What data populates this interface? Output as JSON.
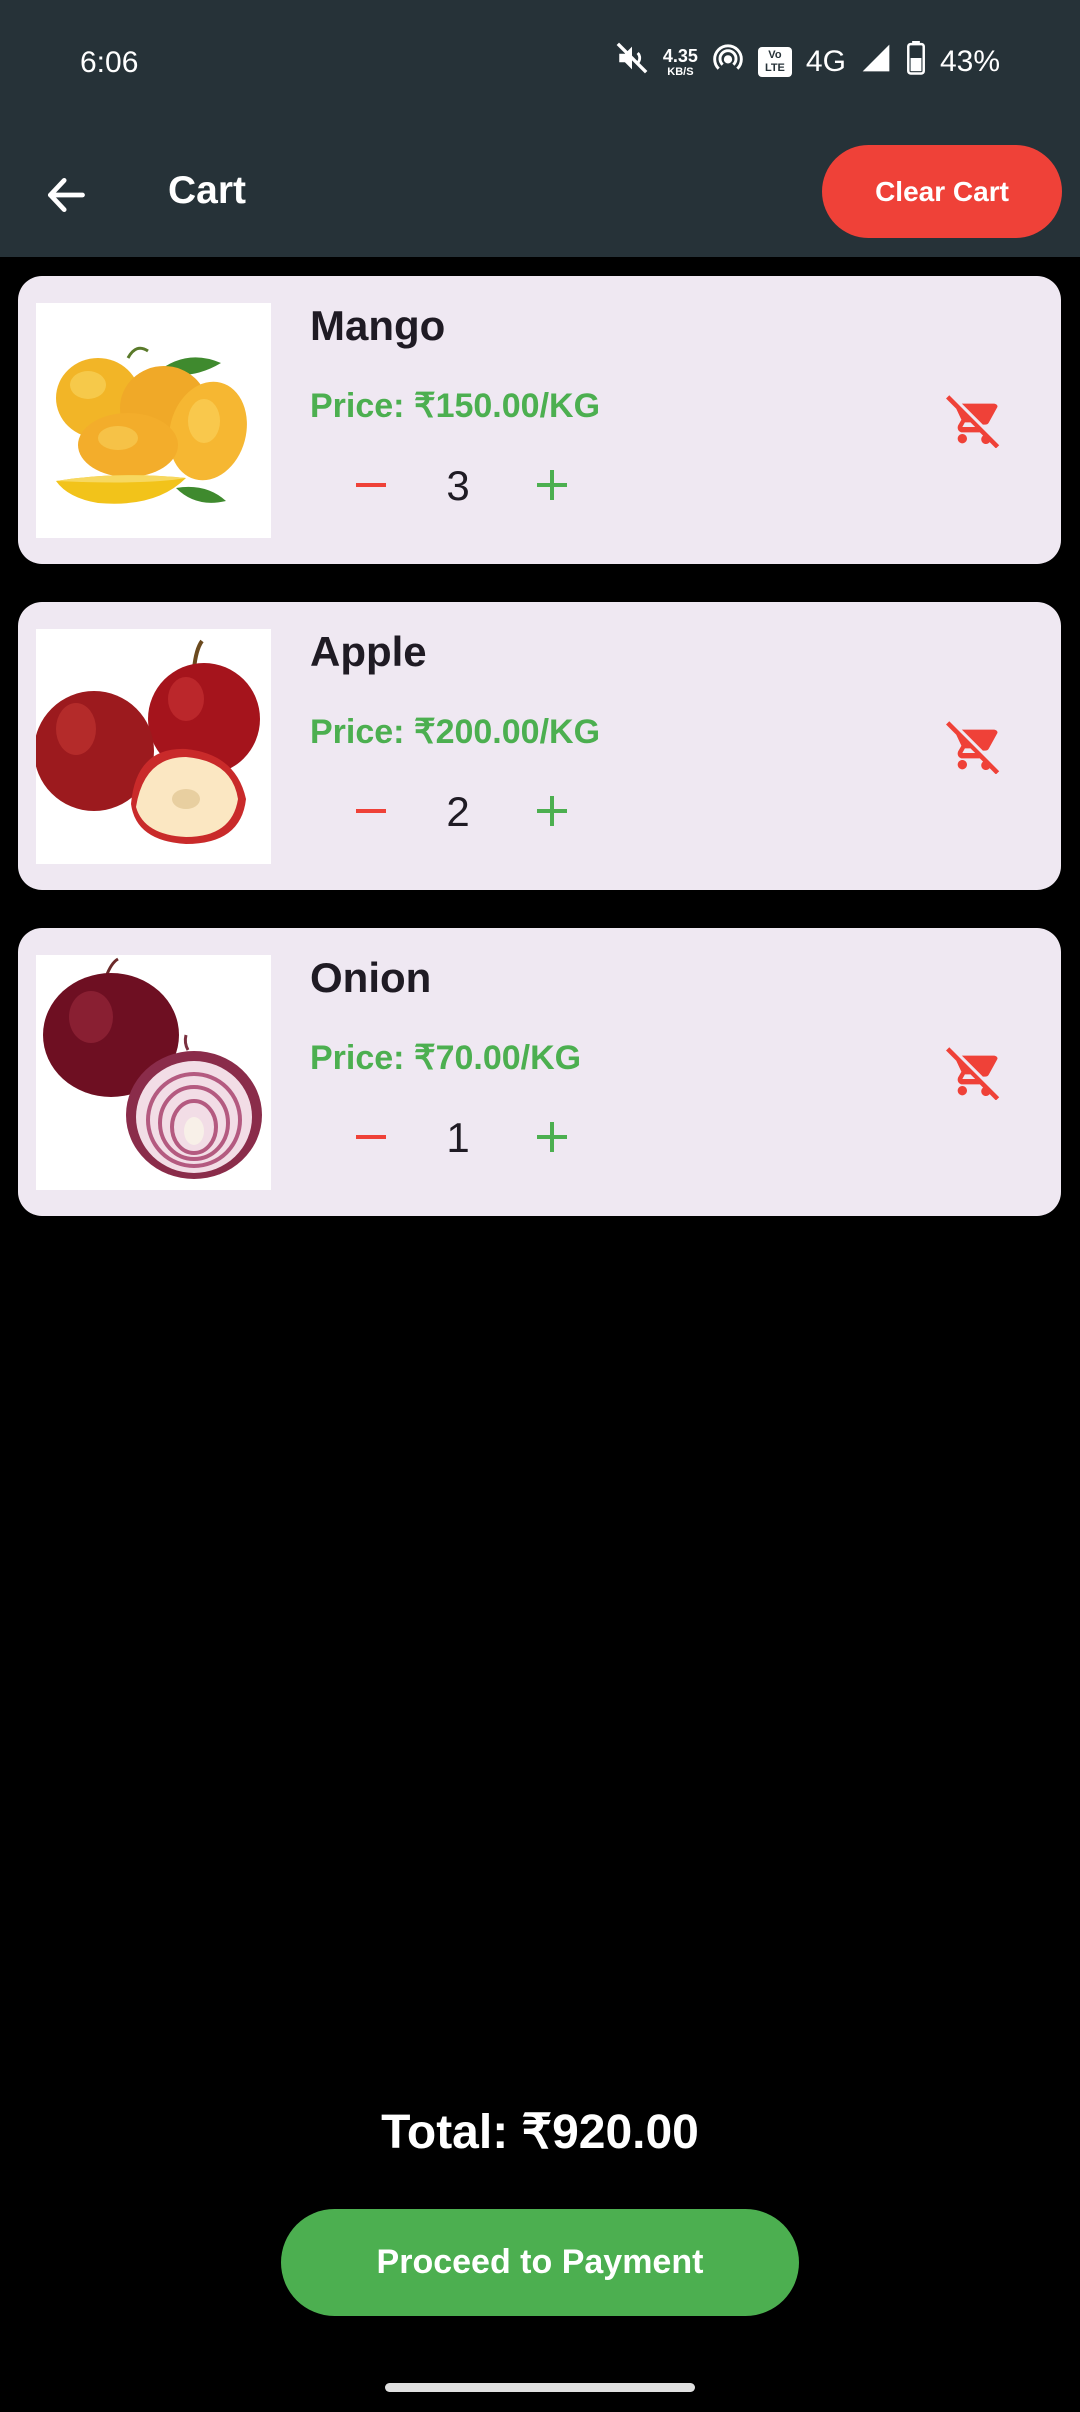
{
  "status_bar": {
    "time": "6:06",
    "net_speed_value": "4.35",
    "net_speed_unit": "KB/S",
    "volte": "Vo LTE",
    "network": "4G",
    "battery": "43%",
    "icons": [
      "mute-icon",
      "hotspot-icon",
      "volte-icon",
      "signal-icon",
      "battery-icon"
    ]
  },
  "app_bar": {
    "title": "Cart",
    "clear_label": "Clear Cart",
    "back_icon": "arrow-left-icon"
  },
  "cart": {
    "items": [
      {
        "name": "Mango",
        "price": "Price: ₹150.00/KG",
        "quantity": "3",
        "image": "mango"
      },
      {
        "name": "Apple",
        "price": "Price: ₹200.00/KG",
        "quantity": "2",
        "image": "apple"
      },
      {
        "name": "Onion",
        "price": "Price: ₹70.00/KG",
        "quantity": "1",
        "image": "onion"
      }
    ]
  },
  "summary": {
    "total": "Total: ₹920.00",
    "pay_label": "Proceed to Payment"
  },
  "colors": {
    "app_bar": "#263238",
    "accent_red": "#ef4138",
    "accent_green": "#4caf50",
    "card_bg": "#efe8f2",
    "page_bg": "#000000"
  }
}
